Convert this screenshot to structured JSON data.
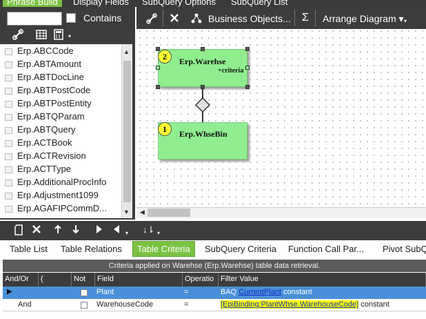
{
  "top_tabs": [
    "Phrase Build",
    "Display Fields",
    "SubQuery Options",
    "SubQuery List"
  ],
  "left": {
    "search": {
      "value": "",
      "placeholder": ""
    },
    "contains_label": "Contains",
    "table_list": [
      "Erp.ABCCode",
      "Erp.ABTAmount",
      "Erp.ABTDocLine",
      "Erp.ABTPostCode",
      "Erp.ABTPostEntity",
      "Erp.ABTQParam",
      "Erp.ABTQuery",
      "Erp.ACTBook",
      "Erp.ACTRevision",
      "Erp.ACTType",
      "Erp.AdditionalProcInfo",
      "Erp.Adjustment1099",
      "Erp.AGAFIPCommD..."
    ]
  },
  "diagram_toolbar": {
    "business_objects": "Business Objects...",
    "sigma": "Σ",
    "arrange": "Arrange Diagram ▾"
  },
  "diagram": {
    "table1": {
      "badge": "2",
      "name": "Erp.Warehse",
      "criteria": "+criteria"
    },
    "table2": {
      "badge": "1",
      "name": "Erp.WhseBin"
    }
  },
  "bottom_tabs": [
    "Table List",
    "Table Relations",
    "Table Criteria",
    "SubQuery Criteria",
    "Function Call Par...",
    "Pivot SubQ"
  ],
  "criteria": {
    "header": "Criteria applied on Warehse (Erp.Warehse) table data retrieval.",
    "columns": [
      "And/Or",
      "(",
      "Not",
      "Field",
      "Operatio",
      "Filter Value"
    ],
    "rows": [
      {
        "andor": "",
        "field": "Plant",
        "op": "=",
        "fv_prefix": "BAQ ",
        "fv_link": "CurrentPlant",
        "fv_suffix": " constant"
      },
      {
        "andor": "And",
        "field": "WarehouseCode",
        "op": "=",
        "fv_prefix": "",
        "fv_link": "[EpiBinding:PlantWhse.WarehouseCode]",
        "fv_suffix": " constant"
      }
    ]
  },
  "colors": {
    "accent": "#7cc242",
    "table_box": "#90ee90",
    "selected_row": "#4a90d9"
  }
}
